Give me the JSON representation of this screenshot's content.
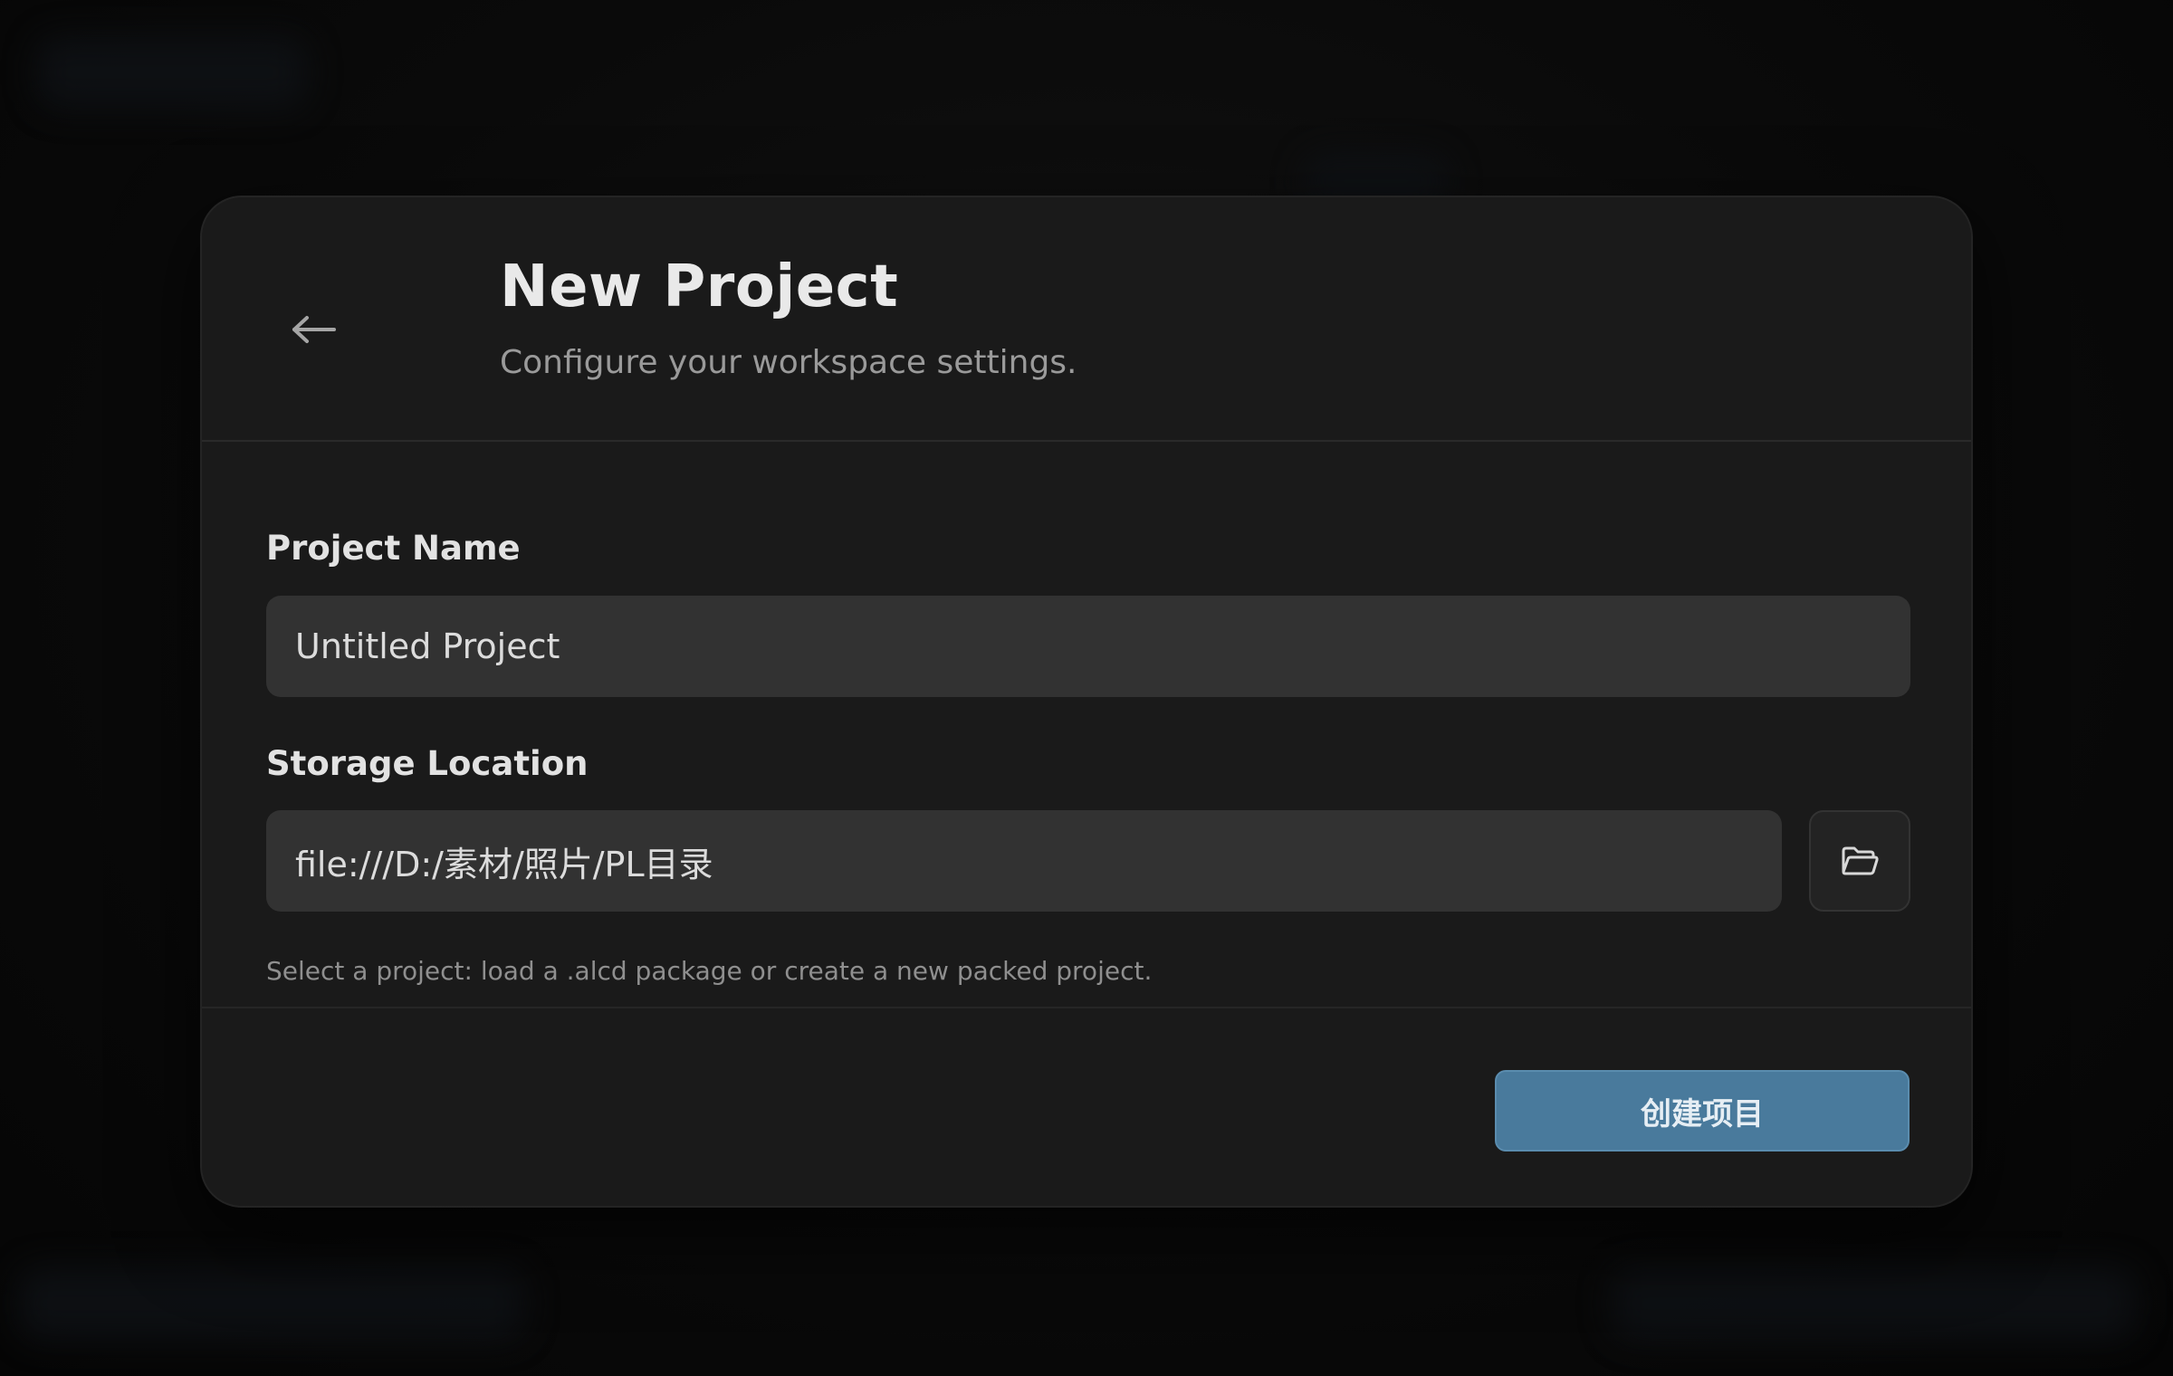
{
  "dialog": {
    "title": "New Project",
    "subtitle": "Configure your workspace settings.",
    "back_icon": "arrow-left-icon"
  },
  "project_name": {
    "label": "Project Name",
    "value": "Untitled Project"
  },
  "storage_location": {
    "label": "Storage Location",
    "value": "file:///D:/素材/照片/PL目录",
    "browse_icon": "folder-open-icon"
  },
  "helper_text": "Select a project: load a .alcd package or create a new packed project.",
  "create_button": {
    "label": "创建项目"
  },
  "colors": {
    "accent": "#497a9c",
    "surface": "#1a1a1a",
    "input_bg": "#323232"
  }
}
